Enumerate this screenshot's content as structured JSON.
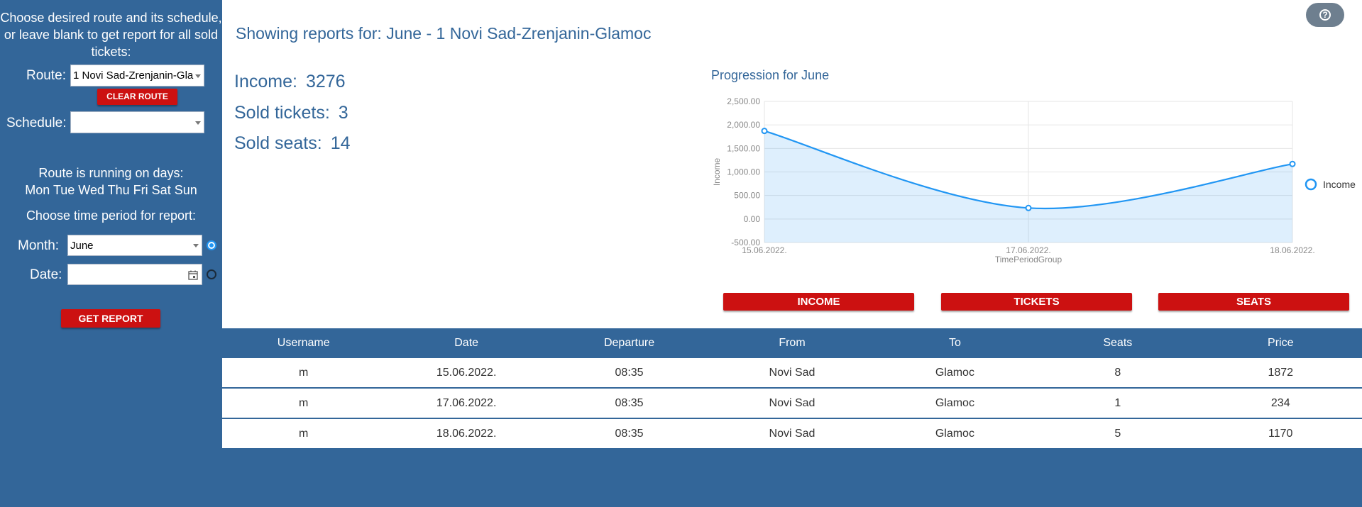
{
  "sidebar": {
    "intro": "Choose desired route and its schedule, or leave blank to get report for all sold tickets:",
    "route_label": "Route:",
    "route_value": "1 Novi Sad-Zrenjanin-Gla",
    "clear_route": "CLEAR ROUTE",
    "schedule_label": "Schedule:",
    "schedule_value": "",
    "running_days_title": "Route is running on days:",
    "running_days": "Mon Tue Wed Thu Fri Sat Sun",
    "period_title": "Choose time period for report:",
    "month_label": "Month:",
    "month_value": "June",
    "month_selected": true,
    "date_label": "Date:",
    "date_value": "",
    "date_selected": false,
    "get_report": "GET REPORT"
  },
  "header": {
    "title": "Showing reports for: June - 1 Novi Sad-Zrenjanin-Glamoc"
  },
  "stats": {
    "income_label": "Income:",
    "income_value": "3276",
    "tickets_label": "Sold tickets:",
    "tickets_value": "3",
    "seats_label": "Sold seats:",
    "seats_value": "14"
  },
  "chart_title": "Progression for June",
  "chart_buttons": {
    "income": "INCOME",
    "tickets": "TICKETS",
    "seats": "SEATS"
  },
  "chart_data": {
    "type": "area",
    "title": "Progression for June",
    "x": [
      "15.06.2022.",
      "17.06.2022.",
      "18.06.2022."
    ],
    "series": [
      {
        "name": "Income",
        "values": [
          1872,
          234,
          1170
        ]
      }
    ],
    "xlabel": "TimePeriodGroup",
    "ylabel": "Income",
    "ylim": [
      -500,
      2500
    ],
    "yticks": [
      "2,500.00",
      "2,000.00",
      "1,500.00",
      "1,000.00",
      "500.00",
      "0.00",
      "-500.00"
    ],
    "grid": true,
    "legend": "right",
    "color": "#2196f3"
  },
  "table": {
    "headers": [
      "Username",
      "Date",
      "Departure",
      "From",
      "To",
      "Seats",
      "Price"
    ],
    "rows": [
      [
        "m",
        "15.06.2022.",
        "08:35",
        "Novi Sad",
        "Glamoc",
        "8",
        "1872"
      ],
      [
        "m",
        "17.06.2022.",
        "08:35",
        "Novi Sad",
        "Glamoc",
        "1",
        "234"
      ],
      [
        "m",
        "18.06.2022.",
        "08:35",
        "Novi Sad",
        "Glamoc",
        "5",
        "1170"
      ]
    ]
  },
  "colors": {
    "primary": "#336699",
    "accent": "#cc1111",
    "chart": "#2196f3"
  },
  "help_icon": "help-circle-icon"
}
